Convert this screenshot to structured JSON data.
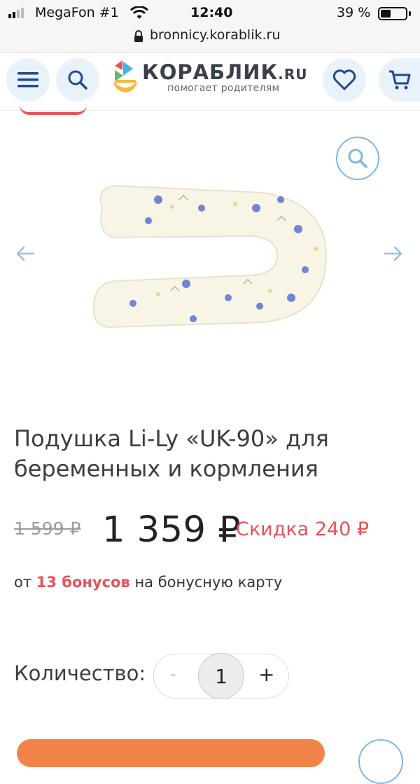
{
  "status_bar": {
    "carrier": "MegaFon #1",
    "time": "12:40",
    "battery": "39 %",
    "battery_level": 0.39
  },
  "browser": {
    "url": "bronnicy.korablik.ru"
  },
  "header": {
    "logo_name": "КОРАБЛИК",
    "logo_domain": ".RU",
    "logo_tagline": "помогает родителям",
    "icons": [
      "menu-icon",
      "search-icon",
      "heart-icon",
      "cart-icon"
    ]
  },
  "gallery": {
    "icons": [
      "zoom-icon",
      "arrow-left-icon",
      "arrow-right-icon"
    ]
  },
  "product": {
    "title": "Подушка Li-Ly «UK-90» для беременных и кормления",
    "old_price": "1 599 ₽",
    "price": "1 359 ₽",
    "discount": "Скидка 240 ₽",
    "bonus_prefix": "от ",
    "bonus_amount": "13 бонусов",
    "bonus_suffix": " на бонусную карту"
  },
  "quantity": {
    "label": "Количество:",
    "minus": "-",
    "value": "1",
    "plus": "+"
  },
  "colors": {
    "accent_red": "#e4535a",
    "accent_blue": "#7ab8e8",
    "cta_orange": "#f2844a",
    "icon_navy": "#1f4a8c"
  }
}
